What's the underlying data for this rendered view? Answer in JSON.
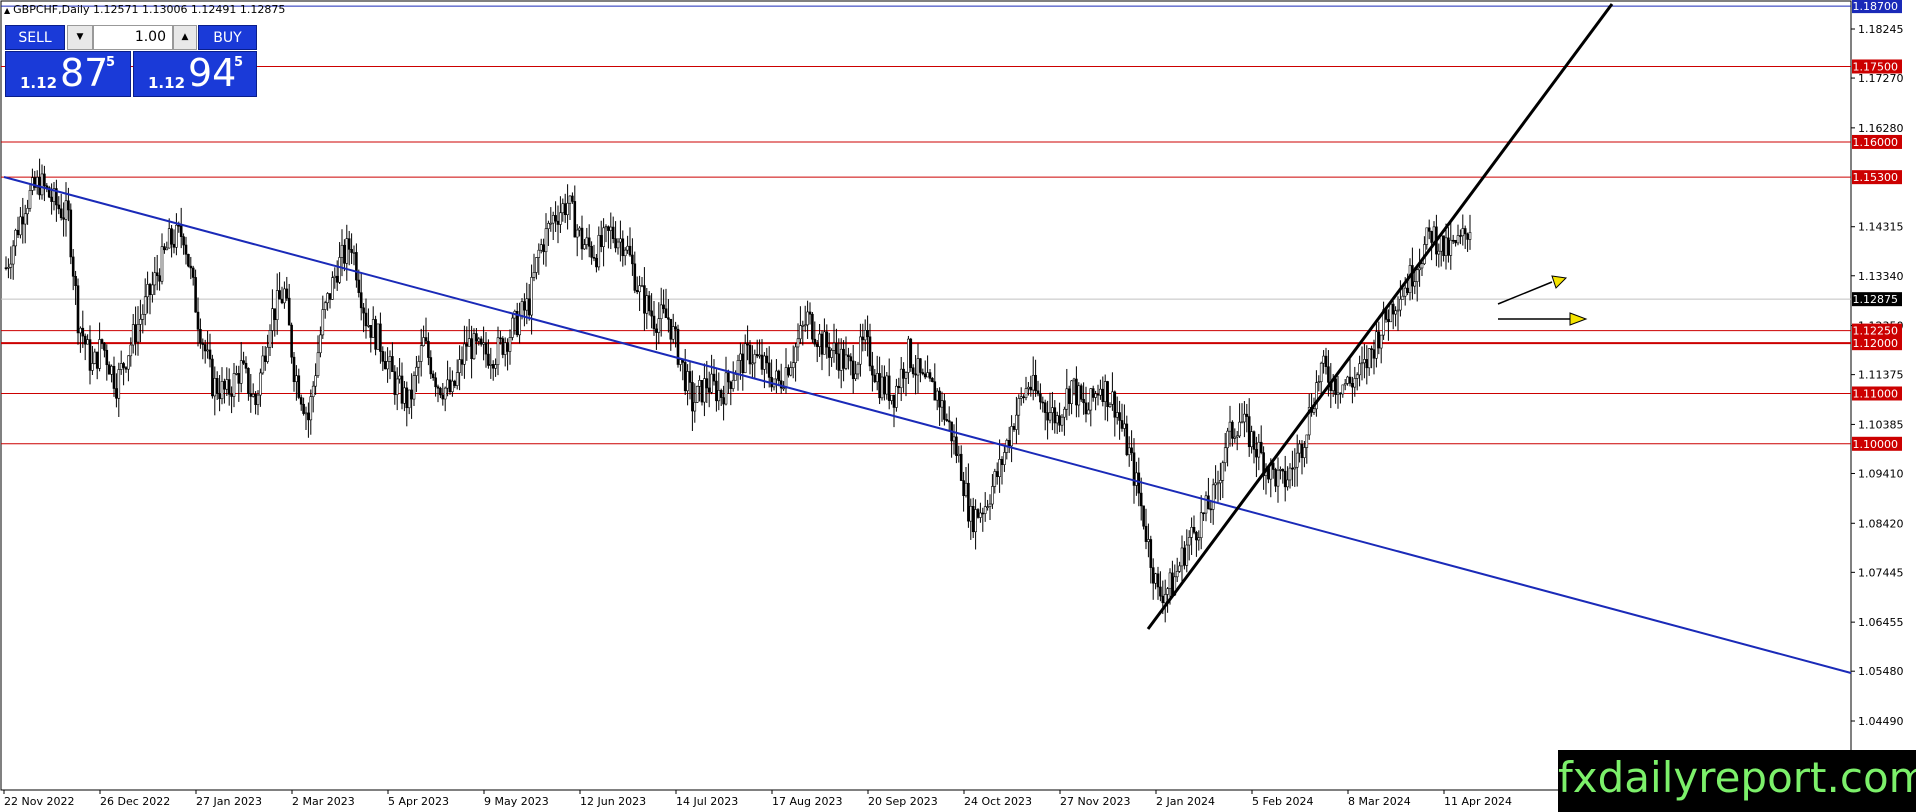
{
  "header": {
    "title": "GBPCHF,Daily  1.12571 1.13006 1.12491 1.12875"
  },
  "trade_panel": {
    "sell_label": "SELL",
    "buy_label": "BUY",
    "lot_value": "1.00",
    "sell_price": {
      "small": "1.12",
      "big": "87",
      "sup": "5"
    },
    "buy_price": {
      "small": "1.12",
      "big": "94",
      "sup": "5"
    }
  },
  "price_axis": {
    "ticks": [
      "1.18245",
      "1.17270",
      "1.16280",
      "1.14315",
      "1.13340",
      "1.12350",
      "1.11375",
      "1.10385",
      "1.09410",
      "1.08420",
      "1.07445",
      "1.06455",
      "1.05480",
      "1.04490"
    ],
    "tick_values": [
      1.18245,
      1.1727,
      1.1628,
      1.14315,
      1.1334,
      1.1235,
      1.11375,
      1.10385,
      1.0941,
      1.0842,
      1.07445,
      1.06455,
      1.0548,
      1.0449
    ],
    "current_price_label": "1.12875",
    "current_price": 1.12875
  },
  "levels": [
    {
      "label": "1.18700",
      "value": 1.187,
      "color": "#1a2ab8"
    },
    {
      "label": "1.17500",
      "value": 1.175,
      "color": "#cc0000"
    },
    {
      "label": "1.16000",
      "value": 1.16,
      "color": "#cc0000"
    },
    {
      "label": "1.15300",
      "value": 1.153,
      "color": "#cc0000"
    },
    {
      "label": "1.12250",
      "value": 1.1225,
      "color": "#cc0000"
    },
    {
      "label": "1.12000",
      "value": 1.12,
      "color": "#cc0000"
    },
    {
      "label": "1.11000",
      "value": 1.11,
      "color": "#cc0000"
    },
    {
      "label": "1.10000",
      "value": 1.1,
      "color": "#cc0000"
    }
  ],
  "time_axis": {
    "labels": [
      "22 Nov 2022",
      "26 Dec 2022",
      "27 Jan 2023",
      "2 Mar 2023",
      "5 Apr 2023",
      "9 May 2023",
      "12 Jun 2023",
      "14 Jul 2023",
      "17 Aug 2023",
      "20 Sep 2023",
      "24 Oct 2023",
      "27 Nov 2023",
      "2 Jan 2024",
      "5 Feb 2024",
      "8 Mar 2024",
      "11 Apr 2024"
    ]
  },
  "price_path": [
    [
      0,
      1.135
    ],
    [
      8,
      1.148
    ],
    [
      14,
      1.152
    ],
    [
      20,
      1.148
    ],
    [
      26,
      1.145
    ],
    [
      30,
      1.125
    ],
    [
      36,
      1.115
    ],
    [
      40,
      1.12
    ],
    [
      46,
      1.112
    ],
    [
      52,
      1.12
    ],
    [
      60,
      1.13
    ],
    [
      68,
      1.14
    ],
    [
      74,
      1.142
    ],
    [
      80,
      1.125
    ],
    [
      86,
      1.112
    ],
    [
      92,
      1.11
    ],
    [
      98,
      1.115
    ],
    [
      104,
      1.108
    ],
    [
      110,
      1.125
    ],
    [
      116,
      1.13
    ],
    [
      120,
      1.115
    ],
    [
      126,
      1.105
    ],
    [
      132,
      1.125
    ],
    [
      138,
      1.135
    ],
    [
      144,
      1.14
    ],
    [
      150,
      1.125
    ],
    [
      156,
      1.12
    ],
    [
      162,
      1.112
    ],
    [
      168,
      1.108
    ],
    [
      174,
      1.12
    ],
    [
      180,
      1.112
    ],
    [
      186,
      1.11
    ],
    [
      192,
      1.12
    ],
    [
      198,
      1.118
    ],
    [
      204,
      1.118
    ],
    [
      210,
      1.122
    ],
    [
      218,
      1.128
    ],
    [
      222,
      1.138
    ],
    [
      228,
      1.145
    ],
    [
      234,
      1.148
    ],
    [
      240,
      1.14
    ],
    [
      246,
      1.138
    ],
    [
      252,
      1.142
    ],
    [
      258,
      1.14
    ],
    [
      264,
      1.13
    ],
    [
      270,
      1.125
    ],
    [
      276,
      1.125
    ],
    [
      282,
      1.115
    ],
    [
      286,
      1.108
    ],
    [
      292,
      1.112
    ],
    [
      298,
      1.11
    ],
    [
      304,
      1.115
    ],
    [
      310,
      1.118
    ],
    [
      316,
      1.115
    ],
    [
      322,
      1.112
    ],
    [
      328,
      1.118
    ],
    [
      334,
      1.125
    ],
    [
      340,
      1.12
    ],
    [
      346,
      1.118
    ],
    [
      352,
      1.115
    ],
    [
      358,
      1.12
    ],
    [
      364,
      1.112
    ],
    [
      370,
      1.11
    ],
    [
      376,
      1.118
    ],
    [
      382,
      1.112
    ],
    [
      388,
      1.11
    ],
    [
      394,
      1.102
    ],
    [
      398,
      1.095
    ],
    [
      402,
      1.085
    ],
    [
      408,
      1.088
    ],
    [
      414,
      1.095
    ],
    [
      420,
      1.105
    ],
    [
      426,
      1.112
    ],
    [
      432,
      1.108
    ],
    [
      438,
      1.105
    ],
    [
      444,
      1.112
    ],
    [
      450,
      1.106
    ],
    [
      456,
      1.112
    ],
    [
      462,
      1.108
    ],
    [
      468,
      1.098
    ],
    [
      472,
      1.09
    ],
    [
      476,
      1.08
    ],
    [
      480,
      1.07
    ],
    [
      486,
      1.072
    ],
    [
      492,
      1.08
    ],
    [
      498,
      1.085
    ],
    [
      504,
      1.09
    ],
    [
      508,
      1.1
    ],
    [
      514,
      1.105
    ],
    [
      520,
      1.1
    ],
    [
      526,
      1.095
    ],
    [
      532,
      1.092
    ],
    [
      536,
      1.095
    ],
    [
      540,
      1.1
    ],
    [
      544,
      1.108
    ],
    [
      548,
      1.115
    ],
    [
      554,
      1.112
    ],
    [
      560,
      1.112
    ],
    [
      566,
      1.115
    ],
    [
      572,
      1.122
    ],
    [
      578,
      1.128
    ],
    [
      584,
      1.132
    ],
    [
      590,
      1.138
    ],
    [
      594,
      1.142
    ],
    [
      600,
      1.138
    ],
    [
      606,
      1.14
    ],
    [
      612,
      1.145
    ],
    [
      618,
      1.138
    ],
    [
      622,
      1.135
    ],
    [
      626,
      1.125
    ],
    [
      630,
      1.128
    ]
  ]
}
